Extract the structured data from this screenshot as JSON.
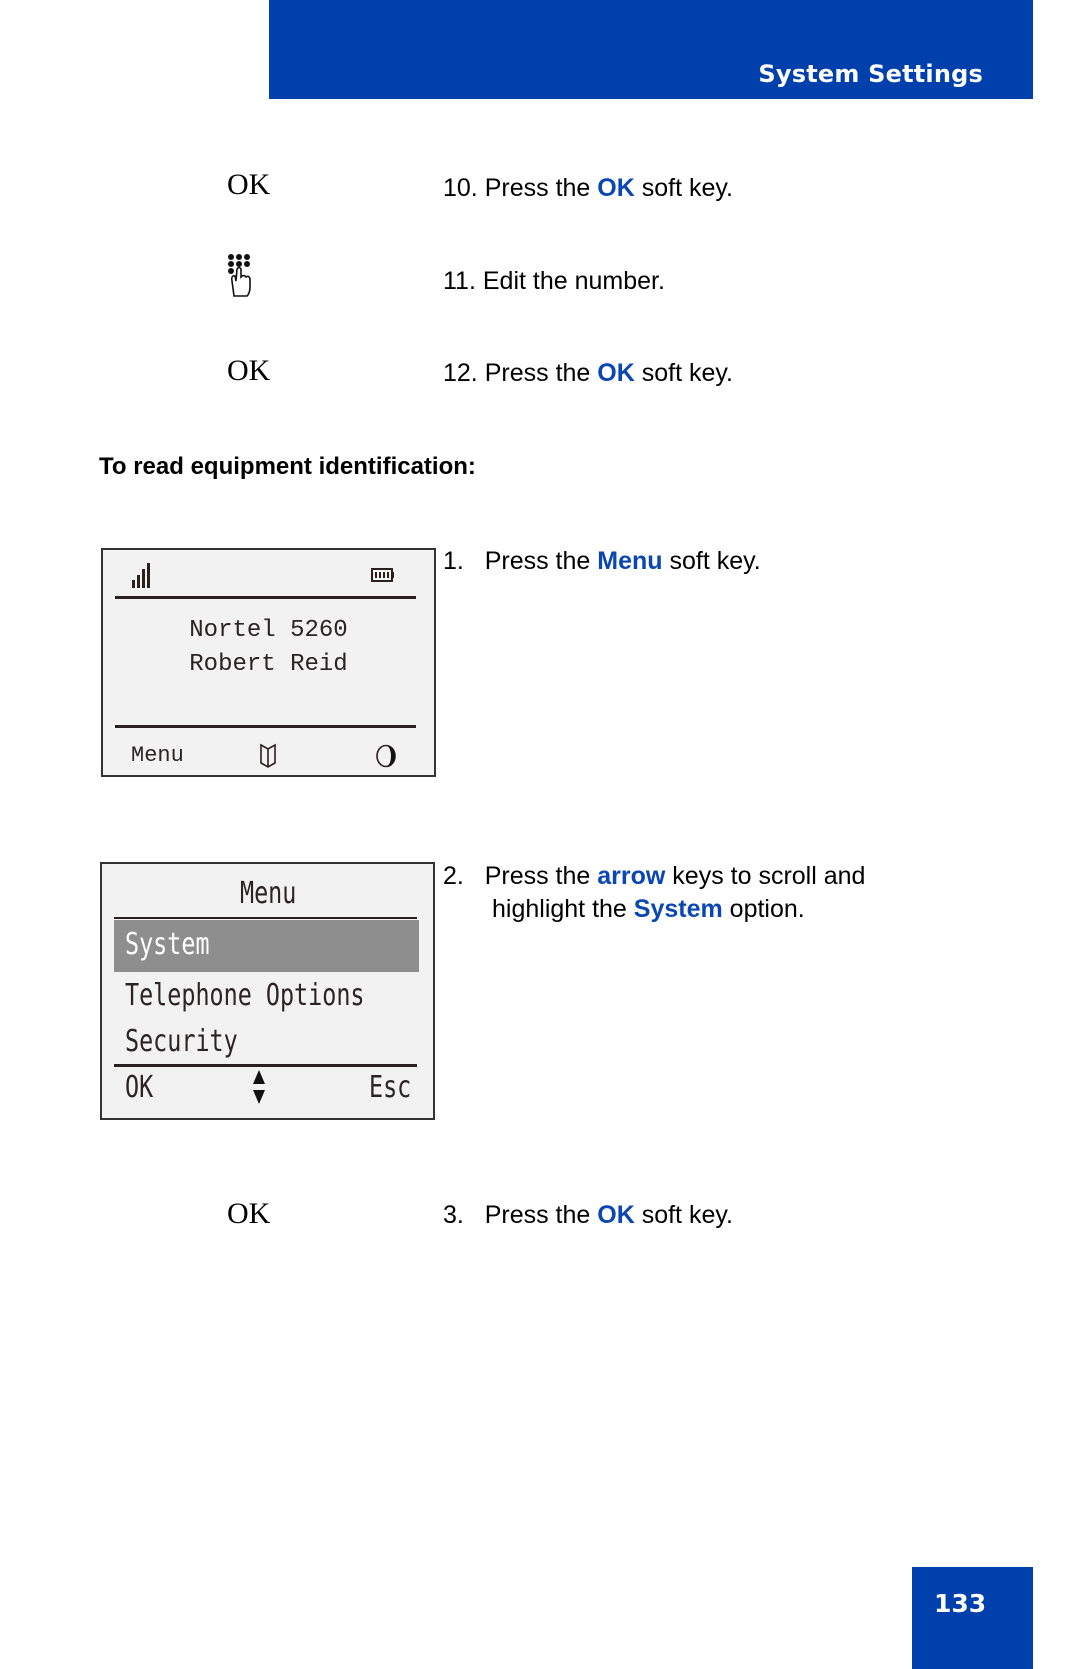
{
  "header": {
    "title": "System Settings"
  },
  "steps_top": [
    {
      "key_label": "OK",
      "number": "10.",
      "pre": "Press the ",
      "highlight": "OK",
      "post": " soft key."
    },
    {
      "key_icon": "keypad-hand-icon",
      "number": "11.",
      "text": "Edit the number."
    },
    {
      "key_label": "OK",
      "number": "12.",
      "pre": "Press the ",
      "highlight": "OK",
      "post": " soft key."
    }
  ],
  "section": {
    "title": "To read equipment identification:"
  },
  "screen1": {
    "line1": "Nortel 5260",
    "line2": "Robert Reid",
    "softkey_left": "Menu",
    "icons": [
      "signal-strength-icon",
      "battery-icon",
      "directory-book-icon",
      "contrast-icon"
    ]
  },
  "screen2": {
    "title": "Menu",
    "items": [
      "System",
      "Telephone Options",
      "Security"
    ],
    "selected_index": 0,
    "softkey_left": "OK",
    "softkey_right": "Esc"
  },
  "steps_bottom": [
    {
      "number": "1.",
      "pre": "Press the ",
      "highlight": "Menu",
      "post": " soft key."
    },
    {
      "number": "2.",
      "pre": "Press the ",
      "highlight": "arrow",
      "post": " keys to scroll and",
      "line2_pre": "highlight the ",
      "line2_highlight": "System",
      "line2_post": " option."
    },
    {
      "key_label": "OK",
      "number": "3.",
      "pre": "Press the ",
      "highlight": "OK",
      "post": " soft key."
    }
  ],
  "footer": {
    "page_number": "133"
  },
  "colors": {
    "brand_blue": "#0040ac",
    "highlight_text": "#0a46b4"
  }
}
